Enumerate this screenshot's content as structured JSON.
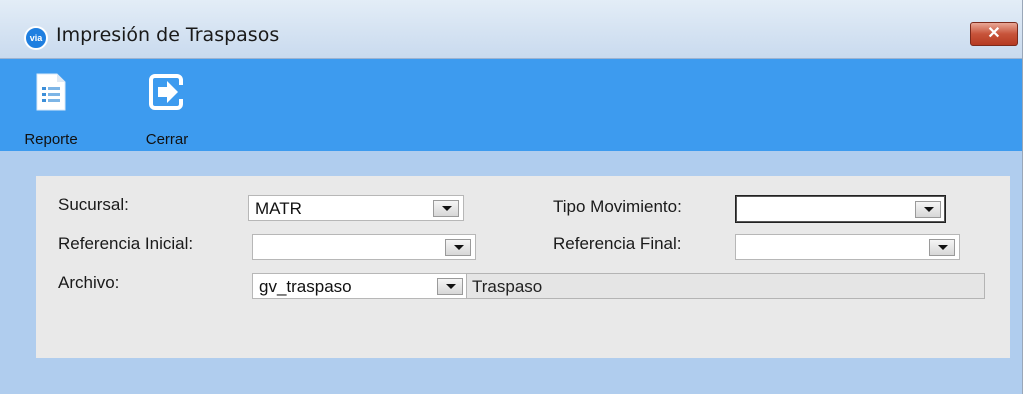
{
  "window": {
    "title": "Impresión de Traspasos",
    "app_icon_text": "via",
    "close_label": "✕"
  },
  "toolbar": {
    "report_label": "Reporte",
    "close_label": "Cerrar"
  },
  "form": {
    "sucursal_label": "Sucursal:",
    "sucursal_value": "MATR",
    "tipo_movimiento_label": "Tipo Movimiento:",
    "tipo_movimiento_value": "",
    "referencia_inicial_label": "Referencia Inicial:",
    "referencia_inicial_value": "",
    "referencia_final_label": "Referencia Final:",
    "referencia_final_value": "",
    "archivo_label": "Archivo:",
    "archivo_value": "gv_traspaso",
    "archivo_description": "Traspaso"
  },
  "colors": {
    "toolbar": "#3d9bef",
    "content": "#b0cdee",
    "panel": "#e9e9e9",
    "close": "#c7533a"
  }
}
